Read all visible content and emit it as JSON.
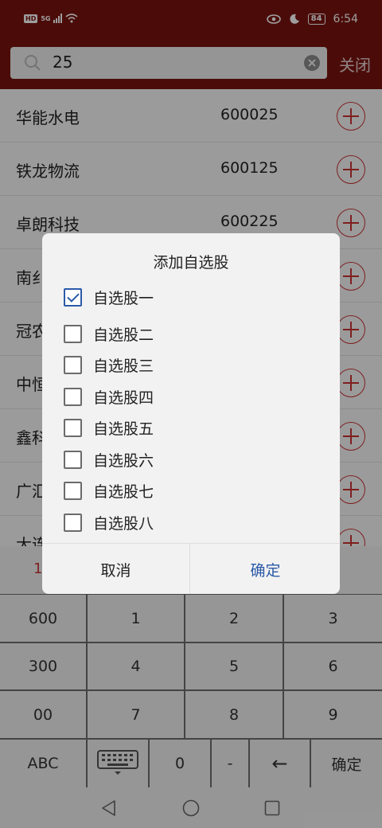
{
  "status_bar": {
    "hd": "HD",
    "network": "5G",
    "battery": "84",
    "time": "6:54"
  },
  "search": {
    "query": "25",
    "close_label": "关闭"
  },
  "stocks": [
    {
      "name": "华能水电",
      "code": "600025"
    },
    {
      "name": "铁龙物流",
      "code": "600125"
    },
    {
      "name": "卓朗科技",
      "code": "600225"
    },
    {
      "name": "南纟",
      "code": ""
    },
    {
      "name": "冠农",
      "code": ""
    },
    {
      "name": "中恒",
      "code": ""
    },
    {
      "name": "鑫科",
      "code": ""
    },
    {
      "name": "广汇",
      "code": ""
    },
    {
      "name": "大连",
      "code": ""
    }
  ],
  "keyboard_top": {
    "left_char": "1"
  },
  "keypad": {
    "k600": "600",
    "k1": "1",
    "k2": "2",
    "k3": "3",
    "k300": "300",
    "k4": "4",
    "k5": "5",
    "k6": "6",
    "k00": "00",
    "k7": "7",
    "k8": "8",
    "k9": "9",
    "abc": "ABC",
    "k0": "0",
    "dash": "-",
    "back": "←",
    "confirm": "确定"
  },
  "dialog": {
    "title": "添加自选股",
    "options": [
      {
        "label": "自选股一",
        "checked": true
      },
      {
        "label": "自选股二",
        "checked": false
      },
      {
        "label": "自选股三",
        "checked": false
      },
      {
        "label": "自选股四",
        "checked": false
      },
      {
        "label": "自选股五",
        "checked": false
      },
      {
        "label": "自选股六",
        "checked": false
      },
      {
        "label": "自选股七",
        "checked": false
      },
      {
        "label": "自选股八",
        "checked": false
      }
    ],
    "cancel_label": "取消",
    "ok_label": "确定"
  },
  "colors": {
    "header": "#7a1410",
    "accent_blue": "#2b5aa8",
    "add_red": "#cc3333"
  },
  "icons": [
    "search-icon",
    "clear-icon",
    "add-circle-icon",
    "keyboard-icon",
    "back-nav-icon",
    "home-nav-icon",
    "recents-nav-icon",
    "eye-icon",
    "moon-icon",
    "wifi-icon",
    "signal-icon"
  ]
}
